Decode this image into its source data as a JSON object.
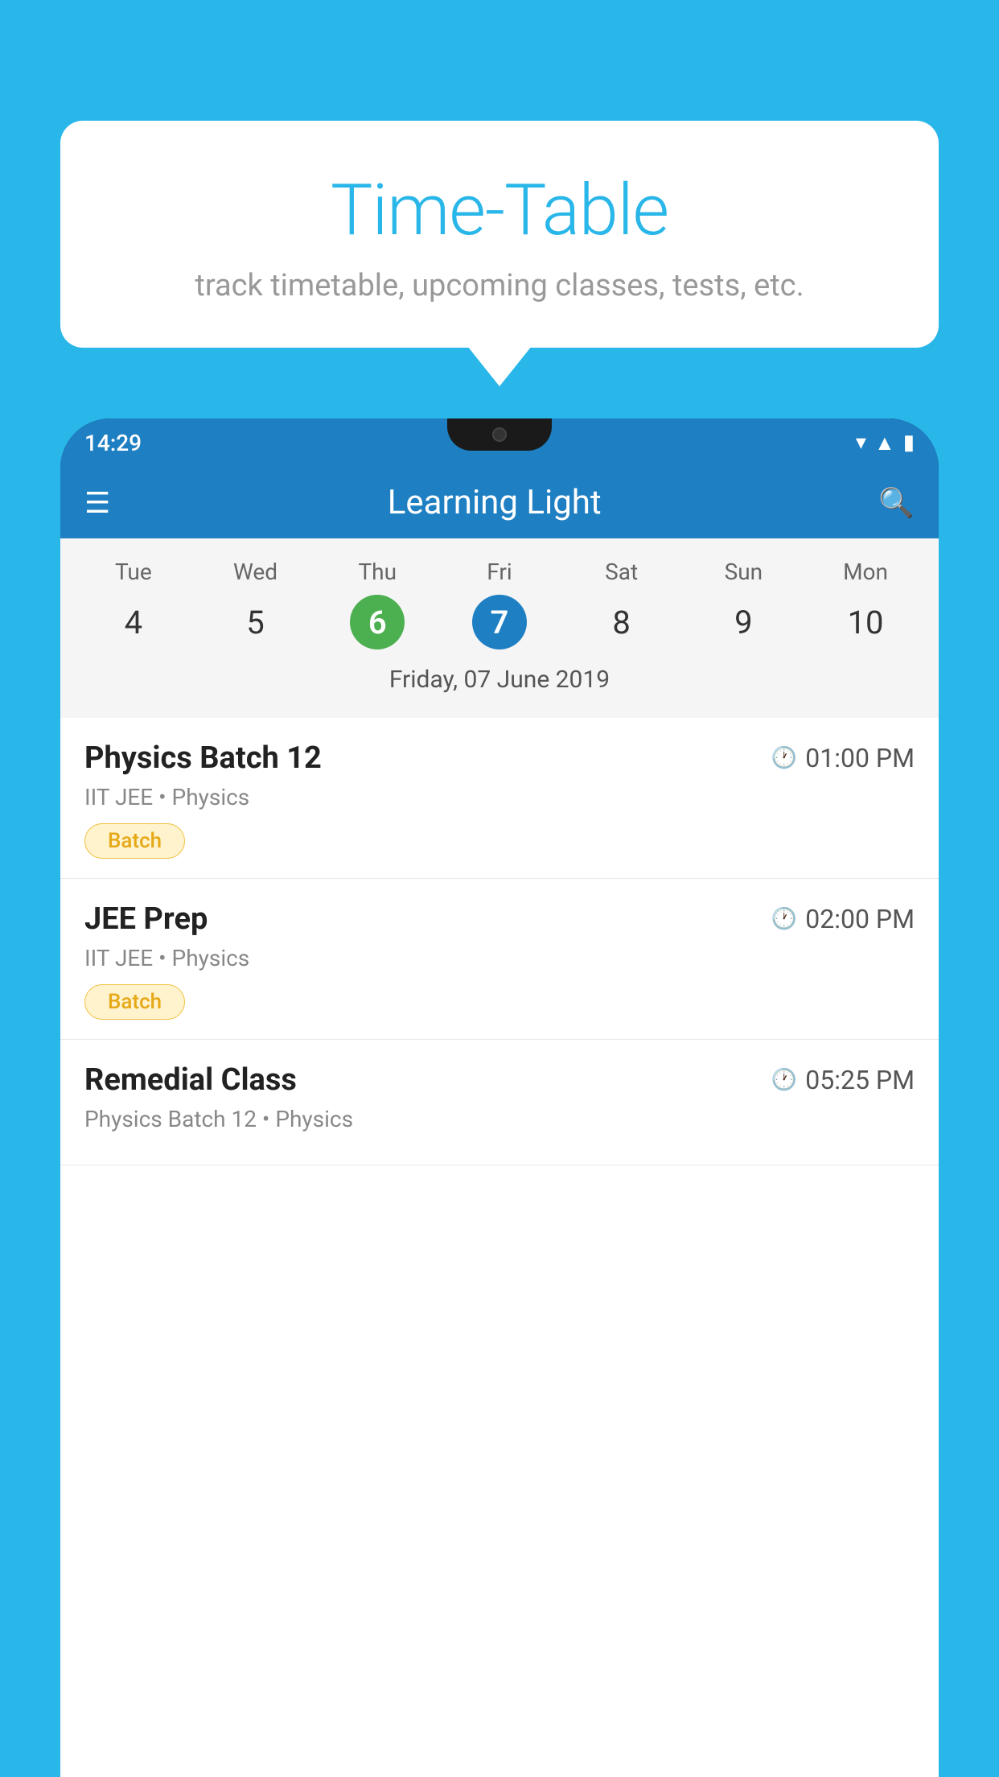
{
  "background_color": "#29b6e8",
  "bubble": {
    "title": "Time-Table",
    "subtitle": "track timetable, upcoming classes, tests, etc."
  },
  "phone": {
    "status_bar": {
      "time": "14:29"
    },
    "app_header": {
      "title": "Learning Light"
    },
    "calendar": {
      "days": [
        {
          "label": "Tue",
          "number": "4",
          "state": "normal"
        },
        {
          "label": "Wed",
          "number": "5",
          "state": "normal"
        },
        {
          "label": "Thu",
          "number": "6",
          "state": "today"
        },
        {
          "label": "Fri",
          "number": "7",
          "state": "selected"
        },
        {
          "label": "Sat",
          "number": "8",
          "state": "normal"
        },
        {
          "label": "Sun",
          "number": "9",
          "state": "normal"
        },
        {
          "label": "Mon",
          "number": "10",
          "state": "normal"
        }
      ],
      "selected_date_label": "Friday, 07 June 2019"
    },
    "schedule": [
      {
        "name": "Physics Batch 12",
        "time": "01:00 PM",
        "subtitle": "IIT JEE • Physics",
        "badge": "Batch"
      },
      {
        "name": "JEE Prep",
        "time": "02:00 PM",
        "subtitle": "IIT JEE • Physics",
        "badge": "Batch"
      },
      {
        "name": "Remedial Class",
        "time": "05:25 PM",
        "subtitle": "Physics Batch 12 • Physics",
        "badge": null
      }
    ]
  }
}
